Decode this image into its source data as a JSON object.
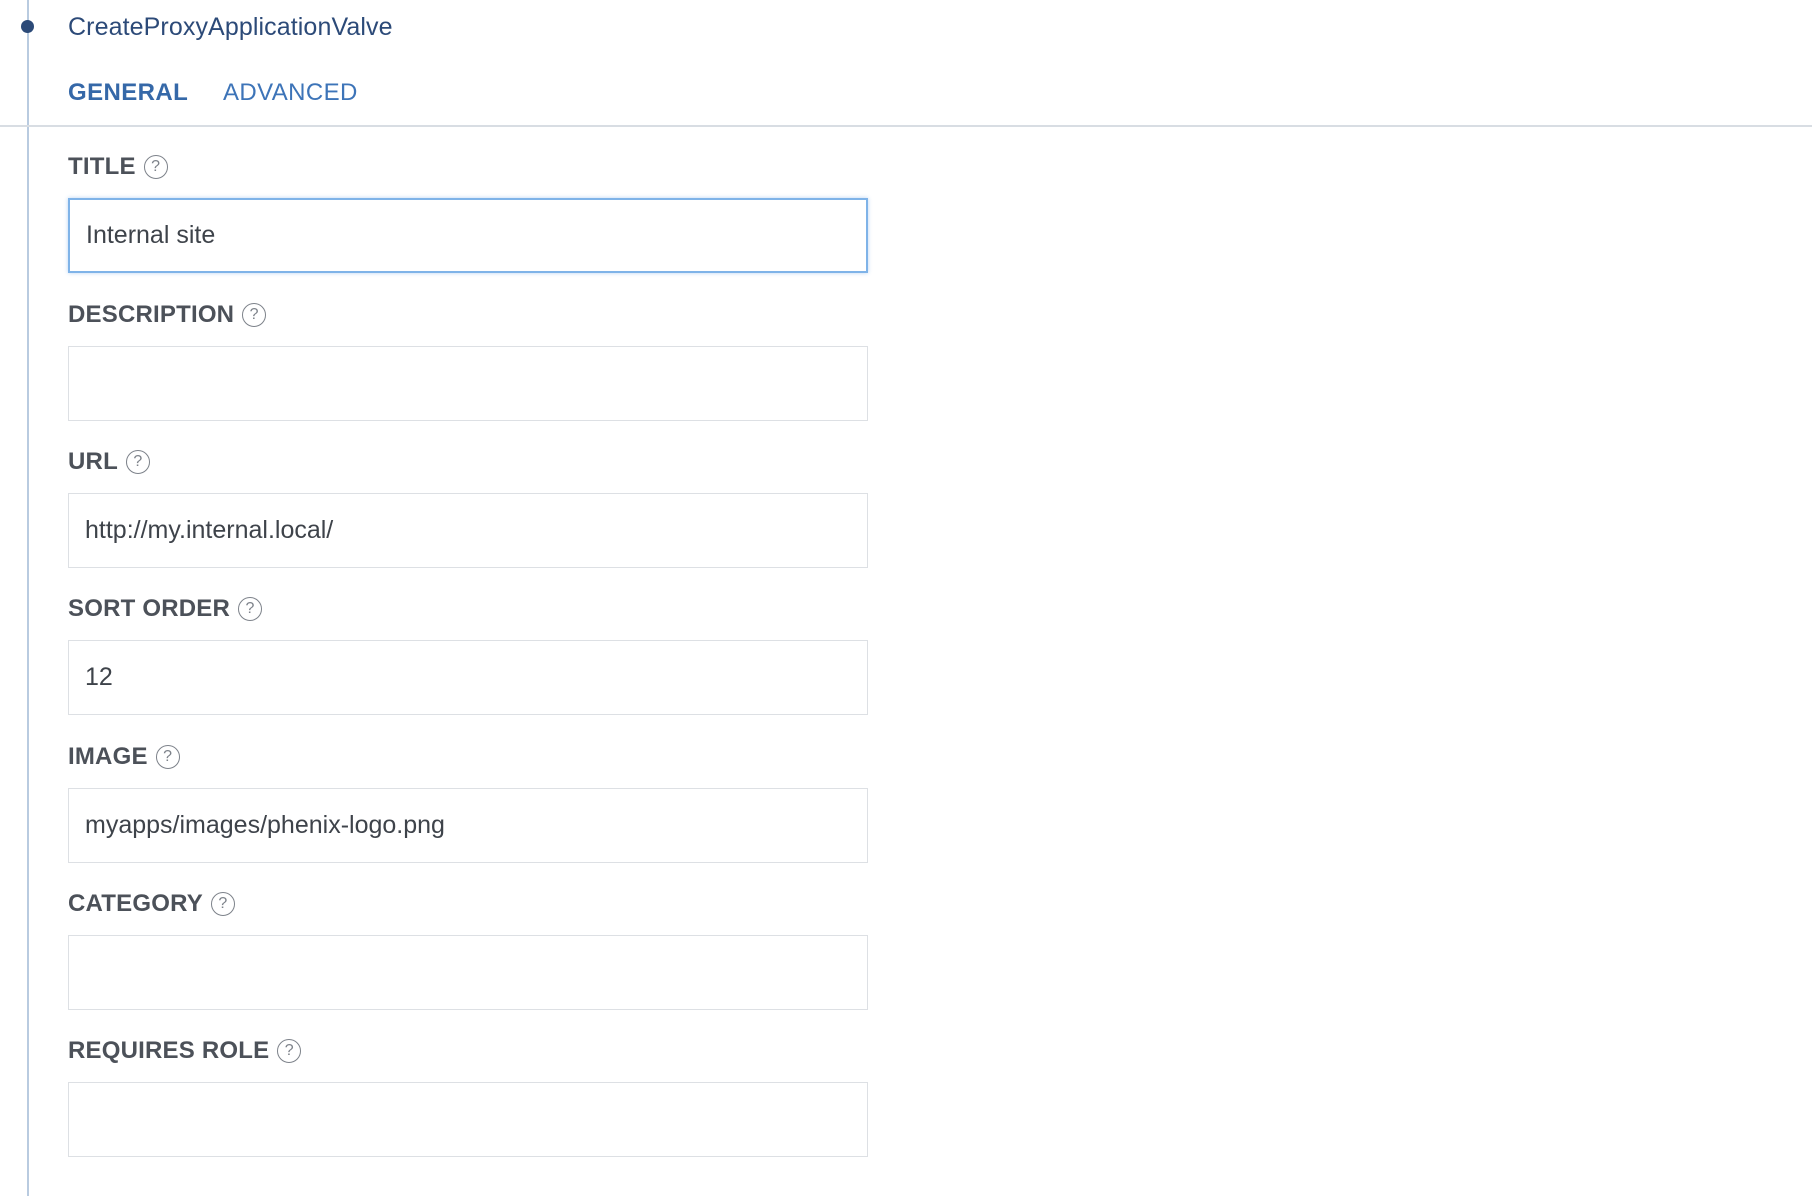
{
  "step": {
    "title": "CreateProxyApplicationValve"
  },
  "tabs": [
    {
      "label": "GENERAL",
      "active": true
    },
    {
      "label": "ADVANCED",
      "active": false
    }
  ],
  "form": {
    "fields": [
      {
        "label": "TITLE",
        "value": "Internal site",
        "help": "?"
      },
      {
        "label": "DESCRIPTION",
        "value": "",
        "help": "?"
      },
      {
        "label": "URL",
        "value": "http://my.internal.local/",
        "help": "?"
      },
      {
        "label": "SORT ORDER",
        "value": "12",
        "help": "?"
      },
      {
        "label": "IMAGE",
        "value": "myapps/images/phenix-logo.png",
        "help": "?"
      },
      {
        "label": "CATEGORY",
        "value": "",
        "help": "?"
      },
      {
        "label": "REQUIRES ROLE",
        "value": "",
        "help": "?"
      }
    ]
  },
  "colors": {
    "accent": "#3d74b8",
    "timeline": "#b9cbe0",
    "timeline_dot": "#2c4a78",
    "focus_border": "#7fb3e8"
  }
}
